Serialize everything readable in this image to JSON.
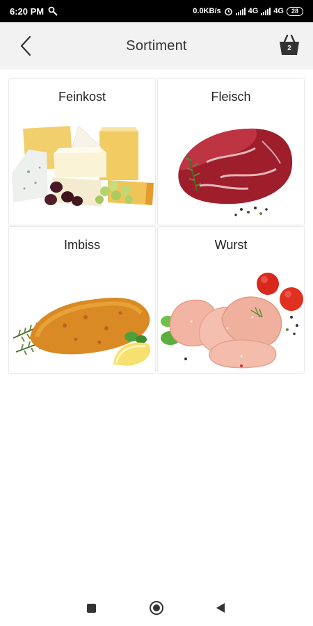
{
  "status_bar": {
    "time": "6:20 PM",
    "speed": "0.0KB/s",
    "network_1": "4G",
    "network_2": "4G",
    "battery": "28"
  },
  "header": {
    "title": "Sortiment",
    "basket_count": "2",
    "back_icon": "chevron-left-icon",
    "basket_icon": "shopping-basket-icon"
  },
  "categories": [
    {
      "label": "Feinkost"
    },
    {
      "label": "Fleisch"
    },
    {
      "label": "Imbiss"
    },
    {
      "label": "Wurst"
    }
  ],
  "nav": {
    "recent_icon": "recent-apps-icon",
    "home_icon": "home-icon",
    "back_icon": "back-triangle-icon"
  },
  "colors": {
    "header_bg": "#f2f2f2",
    "status_bg": "#000000",
    "text": "#222222"
  }
}
